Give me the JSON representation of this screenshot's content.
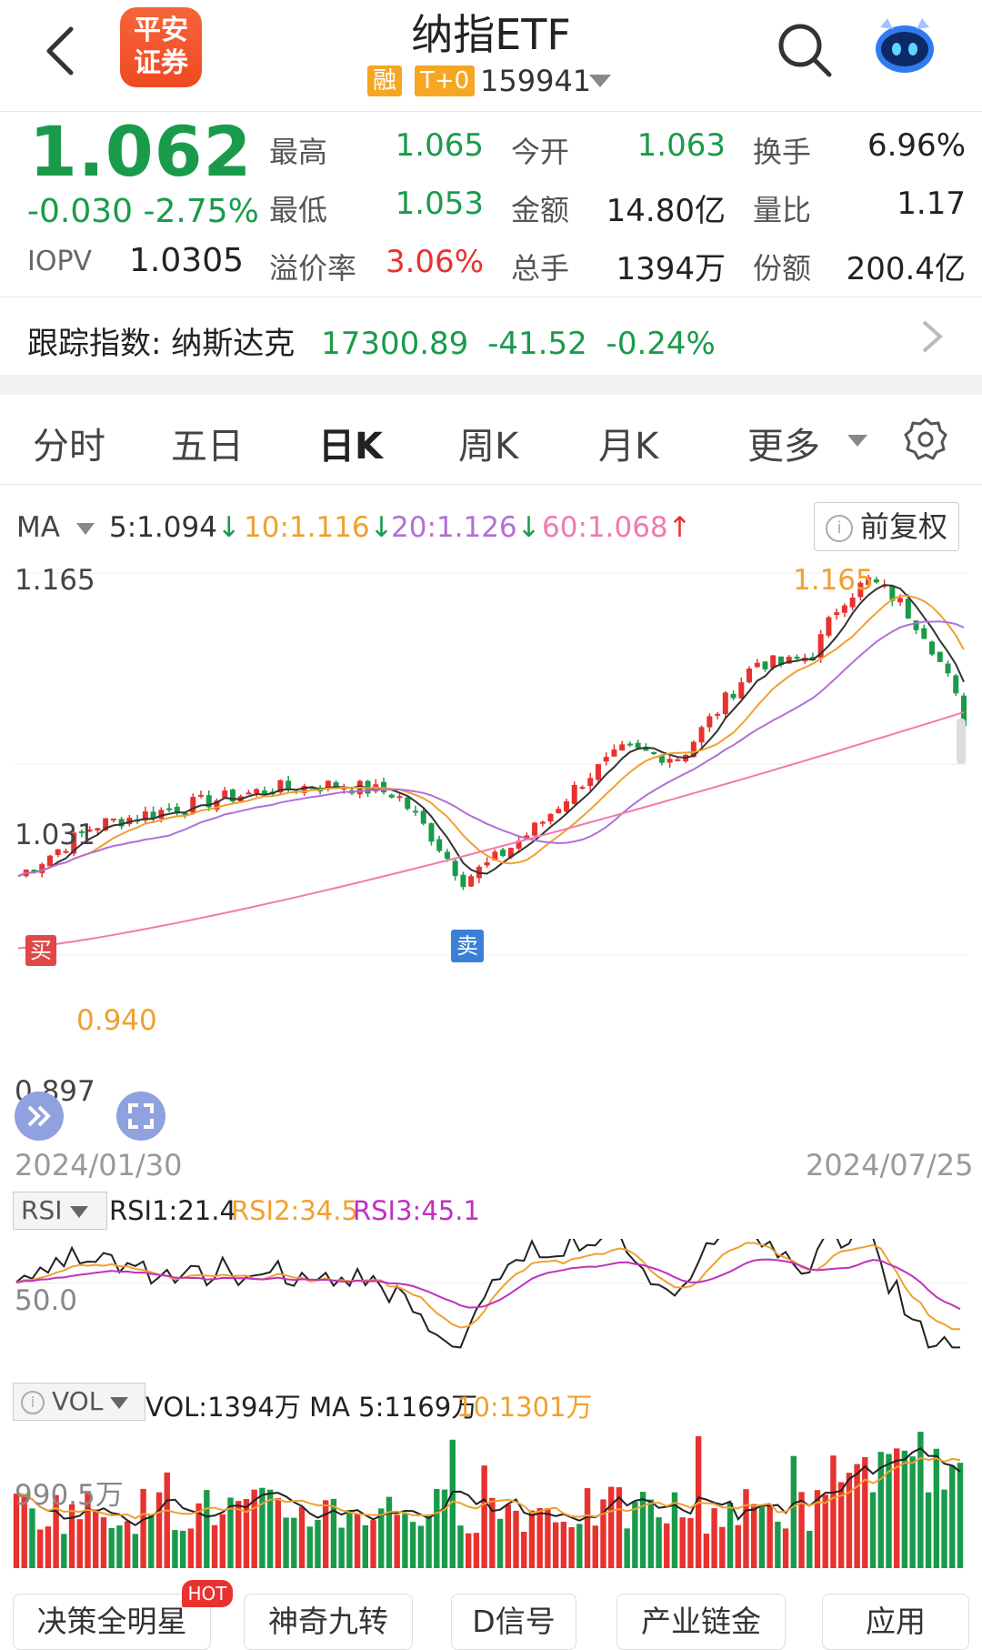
{
  "header": {
    "title": "纳指ETF",
    "logo_line1": "平安",
    "logo_line2": "证券",
    "tag_margin": "融",
    "tag_t0": "T+0",
    "code": "159941"
  },
  "quote": {
    "price": "1.062",
    "change": "-0.030",
    "change_pct": "-2.75%",
    "iopv_label": "IOPV",
    "iopv": "1.0305",
    "high_label": "最高",
    "high": "1.065",
    "low_label": "最低",
    "low": "1.053",
    "premium_label": "溢价率",
    "premium": "3.06%",
    "open_label": "今开",
    "open": "1.063",
    "amount_label": "金额",
    "amount": "14.80亿",
    "volume_label": "总手",
    "volume": "1394万",
    "turnover_label": "换手",
    "turnover": "6.96%",
    "vol_ratio_label": "量比",
    "vol_ratio": "1.17",
    "shares_label": "份额",
    "shares": "200.4亿"
  },
  "tracking": {
    "label": "跟踪指数: 纳斯达克",
    "value": "17300.89",
    "change": "-41.52",
    "change_pct": "-0.24%"
  },
  "tabs": [
    "分时",
    "五日",
    "日K",
    "周K",
    "月K",
    "更多"
  ],
  "active_tab": "日K",
  "ma_bar": {
    "label": "MA",
    "ma5": "5:1.094",
    "ma10": "10:1.116",
    "ma20": "20:1.126",
    "ma60": "60:1.068",
    "adjust": "前复权"
  },
  "kline": {
    "y_top": "1.165",
    "y_mid": "1.031",
    "y_bottom": "0.897",
    "low_mark": "0.940",
    "high_mark": "1.165",
    "buy": "买",
    "sell": "卖",
    "date_start": "2024/01/30",
    "date_end": "2024/07/25"
  },
  "rsi": {
    "selector": "RSI",
    "rsi1": "RSI1:21.4",
    "rsi2": "RSI2:34.5",
    "rsi3": "RSI3:45.1",
    "mid_label": "50.0"
  },
  "vol": {
    "selector": "VOL",
    "vol": "VOL:1394万",
    "ma5": "MA 5:1169万",
    "ma10": "10:1301万",
    "axis_label": "990.5万"
  },
  "bottom_chips": [
    "决策全明星",
    "神奇九转",
    "D信号",
    "产业链金",
    "应用"
  ],
  "hot_badge": "HOT",
  "colors": {
    "up": "#e8322f",
    "down": "#1a9b4b",
    "ma5": "#333333",
    "ma10": "#f0a030",
    "ma20": "#b070d8",
    "ma60": "#f07ab0"
  }
}
